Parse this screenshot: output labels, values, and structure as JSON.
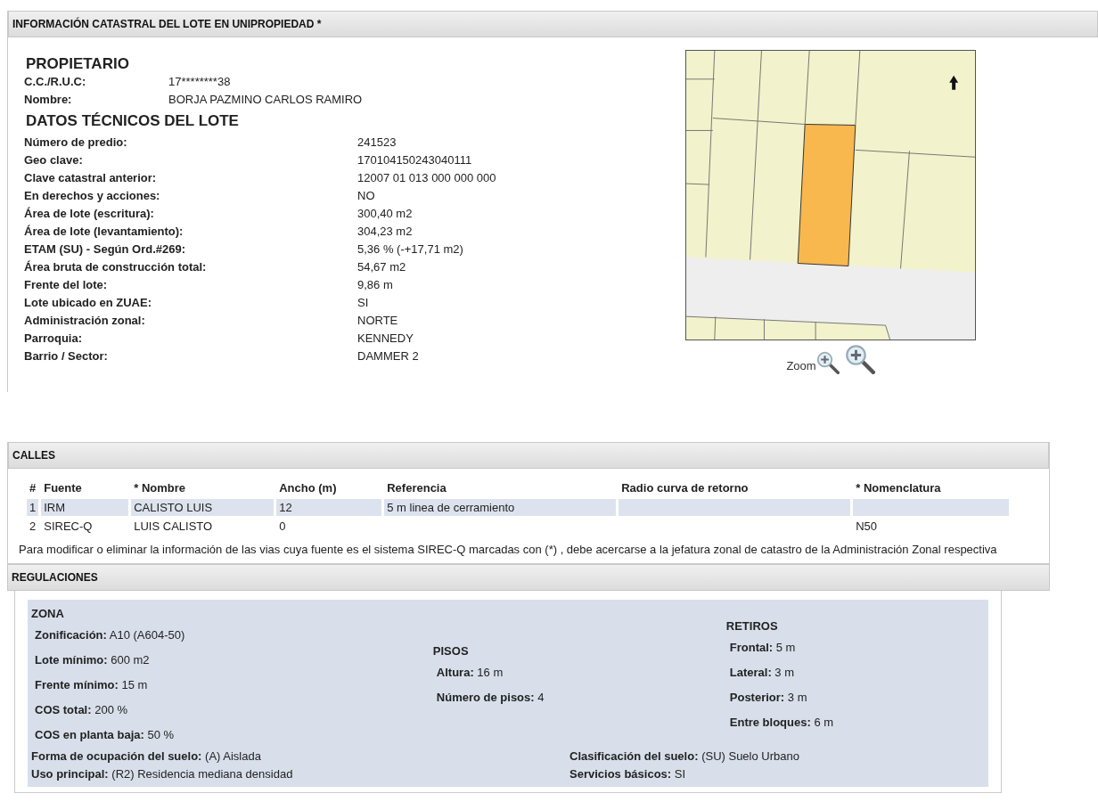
{
  "catastro": {
    "title": "INFORMACIÓN CATASTRAL DEL LOTE EN UNIPROPIEDAD *",
    "propietario": {
      "heading": "PROPIETARIO",
      "fields": [
        {
          "label": "C.C./R.U.C:",
          "value": "17********38"
        },
        {
          "label": "Nombre:",
          "value": "BORJA PAZMINO CARLOS RAMIRO"
        }
      ]
    },
    "datos": {
      "heading": "DATOS TÉCNICOS DEL LOTE",
      "fields": [
        {
          "label": "Número de predio:",
          "value": "241523"
        },
        {
          "label": "Geo clave:",
          "value": "170104150243040111"
        },
        {
          "label": "Clave catastral anterior:",
          "value": "12007 01 013 000 000 000"
        },
        {
          "label": "En derechos y acciones:",
          "value": "NO"
        },
        {
          "label": "Área de lote (escritura):",
          "value": "300,40 m2"
        },
        {
          "label": "Área de lote (levantamiento):",
          "value": "304,23 m2"
        },
        {
          "label": "ETAM (SU) - Según Ord.#269:",
          "value": "5,36 % (-+17,71 m2)"
        },
        {
          "label": "Área bruta de construcción total:",
          "value": "54,67 m2"
        },
        {
          "label": "Frente del lote:",
          "value": "9,86 m"
        },
        {
          "label": "Lote ubicado en ZUAE:",
          "value": "SI"
        },
        {
          "label": "Administración zonal:",
          "value": "NORTE"
        },
        {
          "label": "Parroquia:",
          "value": "KENNEDY"
        },
        {
          "label": "Barrio / Sector:",
          "value": "DAMMER 2"
        }
      ]
    },
    "map": {
      "kind": "picture",
      "zoom_label": "Zoom"
    }
  },
  "calles": {
    "title": "CALLES",
    "columns": [
      "#",
      "Fuente",
      "* Nombre",
      "Ancho (m)",
      "Referencia",
      "Radio curva de retorno",
      "* Nomenclatura"
    ],
    "rows": [
      [
        "1",
        "IRM",
        "CALISTO LUIS",
        "12",
        "5 m linea de cerramiento",
        "",
        ""
      ],
      [
        "2",
        "SIREC-Q",
        "LUIS CALISTO",
        "0",
        "",
        "",
        "N50"
      ]
    ],
    "note": "Para modificar o eliminar la información de las vias cuya fuente es el sistema SIREC-Q marcadas con (*) , debe acercarse a la jefatura zonal de catastro de la Administración Zonal respectiva"
  },
  "regulaciones": {
    "title": "REGULACIONES",
    "zona": {
      "heading": "ZONA",
      "fields": [
        {
          "label": "Zonificación:",
          "value": "A10 (A604-50)"
        },
        {
          "label": "Lote mínimo:",
          "value": "600 m2"
        },
        {
          "label": "Frente mínimo:",
          "value": "15 m"
        },
        {
          "label": "COS total:",
          "value": "200 %"
        },
        {
          "label": "COS en planta baja:",
          "value": "50 %"
        }
      ]
    },
    "pisos": {
      "heading": "PISOS",
      "fields": [
        {
          "label": "Altura:",
          "value": "16 m"
        },
        {
          "label": "Número de pisos:",
          "value": "4"
        }
      ]
    },
    "retiros": {
      "heading": "RETIROS",
      "fields": [
        {
          "label": "Frontal:",
          "value": "5 m"
        },
        {
          "label": "Lateral:",
          "value": "3 m"
        },
        {
          "label": "Posterior:",
          "value": "3 m"
        },
        {
          "label": "Entre bloques:",
          "value": "6 m"
        }
      ]
    },
    "suelo_left": [
      {
        "label": "Forma de ocupación del suelo:",
        "value": "(A) Aislada"
      },
      {
        "label": "Uso principal:",
        "value": "(R2) Residencia mediana densidad"
      }
    ],
    "suelo_right": [
      {
        "label": "Clasificación del suelo:",
        "value": "(SU) Suelo Urbano"
      },
      {
        "label": "Servicios básicos:",
        "value": "SI"
      }
    ]
  }
}
